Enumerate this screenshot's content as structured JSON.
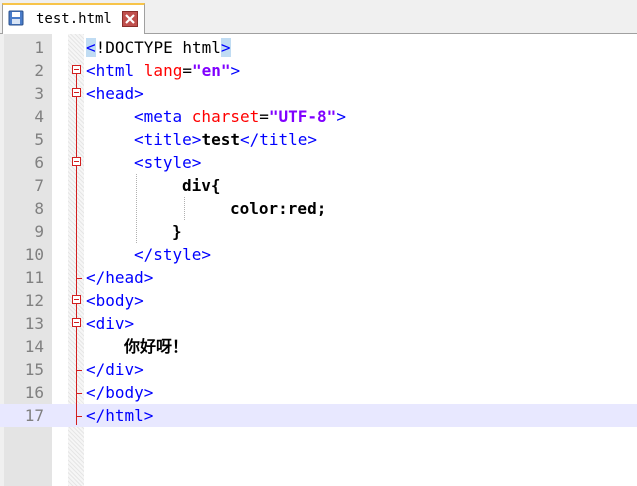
{
  "tab": {
    "title": "test.html",
    "save_icon": "save-icon",
    "close_icon": "close-icon"
  },
  "editor": {
    "current_line": 17,
    "lines": [
      {
        "num": "1"
      },
      {
        "num": "2"
      },
      {
        "num": "3"
      },
      {
        "num": "4"
      },
      {
        "num": "5"
      },
      {
        "num": "6"
      },
      {
        "num": "7"
      },
      {
        "num": "8"
      },
      {
        "num": "9"
      },
      {
        "num": "10"
      },
      {
        "num": "11"
      },
      {
        "num": "12"
      },
      {
        "num": "13"
      },
      {
        "num": "14"
      },
      {
        "num": "15"
      },
      {
        "num": "16"
      },
      {
        "num": "17"
      }
    ],
    "code": {
      "l1_a": "<",
      "l1_b": "!DOCTYPE html",
      "l1_c": ">",
      "l2_open": "<html ",
      "l2_attr": "lang",
      "l2_eq": "=",
      "l2_val": "\"en\"",
      "l2_close": ">",
      "l3": "<head>",
      "l4_open": "<meta ",
      "l4_attr": "charset",
      "l4_eq": "=",
      "l4_val": "\"UTF-8\"",
      "l4_close": ">",
      "l5_open": "<title>",
      "l5_text": "test",
      "l5_close": "</title>",
      "l6": "<style>",
      "l7": "div{",
      "l8": "color:red;",
      "l9": "}",
      "l10": "</style>",
      "l11": "</head>",
      "l12": "<body>",
      "l13": "<div>",
      "l14": "你好呀！",
      "l15": "</div>",
      "l16": "</body>",
      "l17": "</html>"
    }
  }
}
